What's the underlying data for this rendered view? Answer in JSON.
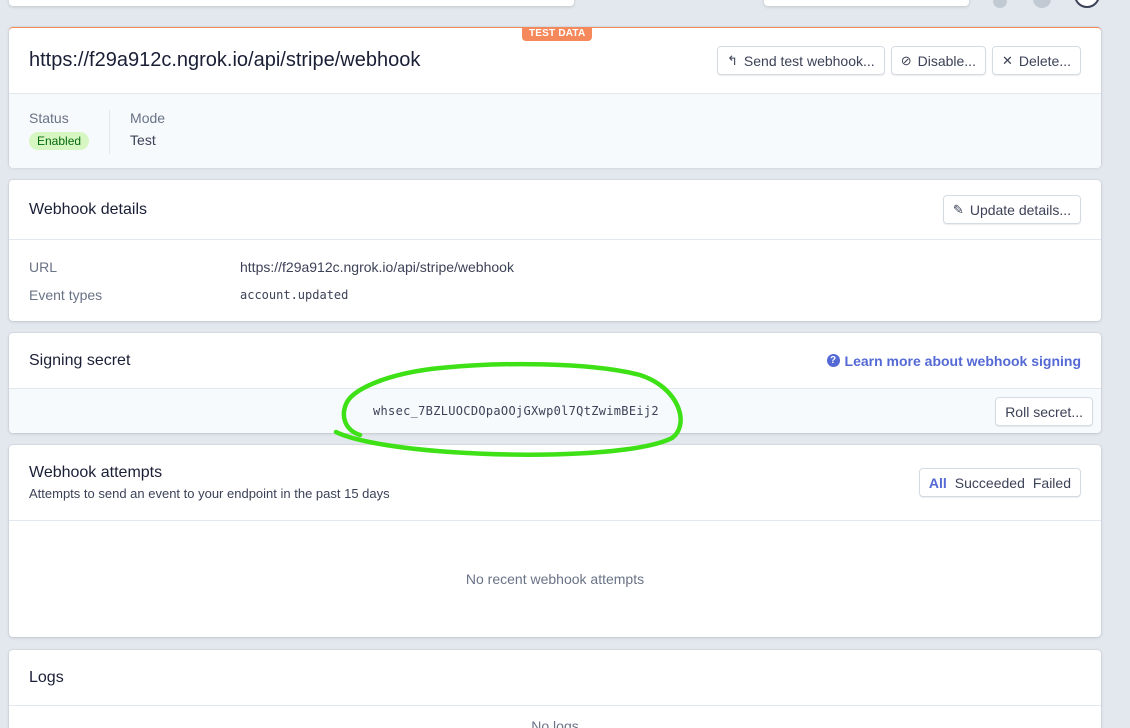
{
  "test_data_badge": "TEST DATA",
  "endpoint": {
    "url": "https://f29a912c.ngrok.io/api/stripe/webhook",
    "actions": {
      "send_test": "Send test webhook...",
      "disable": "Disable...",
      "delete": "Delete..."
    },
    "status_label": "Status",
    "status_value": "Enabled",
    "mode_label": "Mode",
    "mode_value": "Test"
  },
  "details": {
    "title": "Webhook details",
    "update_button": "Update details...",
    "url_label": "URL",
    "url_value": "https://f29a912c.ngrok.io/api/stripe/webhook",
    "event_types_label": "Event types",
    "event_types_value": "account.updated"
  },
  "signing": {
    "title": "Signing secret",
    "learn_more": "Learn more about webhook signing",
    "secret": "whsec_7BZLUOCDOpaOOjGXwp0l7QtZwimBEij2",
    "roll_button": "Roll secret..."
  },
  "attempts": {
    "title": "Webhook attempts",
    "subtitle": "Attempts to send an event to your endpoint in the past 15 days",
    "filters": [
      "All",
      "Succeeded",
      "Failed"
    ],
    "empty": "No recent webhook attempts"
  },
  "logs": {
    "title": "Logs",
    "empty": "No logs"
  },
  "colors": {
    "accent": "#5469d4",
    "annotation": "#3ee016",
    "badge_bg": "#d7f7c2",
    "test_badge": "#f5895b"
  }
}
